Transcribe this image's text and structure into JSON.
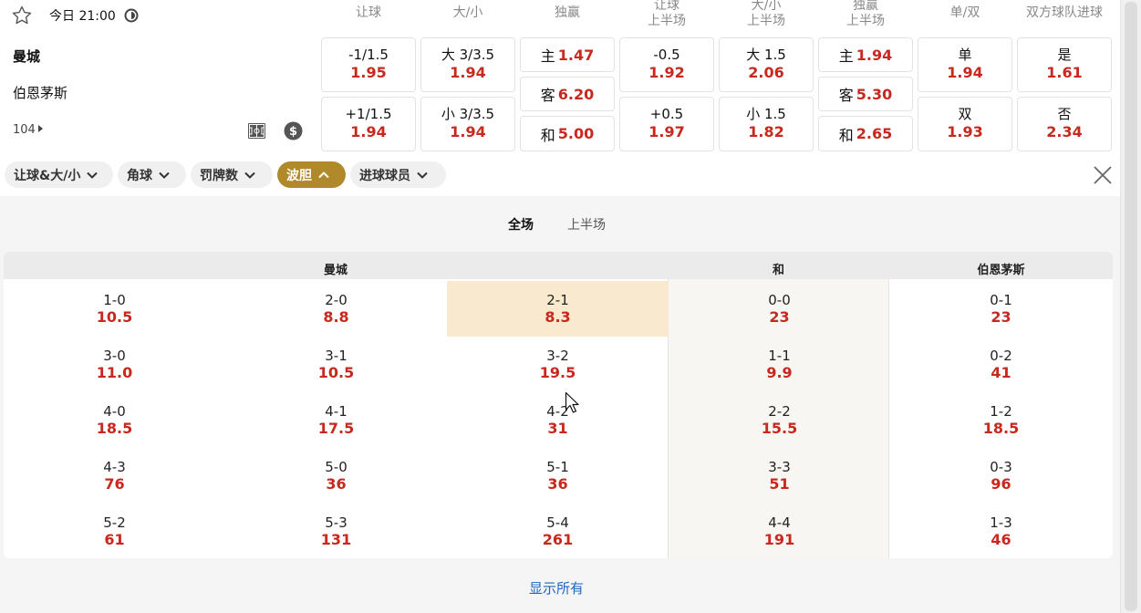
{
  "match": {
    "time": "今日 21:00",
    "home": "曼城",
    "away": "伯恩茅斯",
    "more_markets": "104"
  },
  "columns": [
    {
      "l1": "让球",
      "l2": ""
    },
    {
      "l1": "大/小",
      "l2": ""
    },
    {
      "l1": "独赢",
      "l2": ""
    },
    {
      "l1": "让球",
      "l2": "上半场"
    },
    {
      "l1": "大/小",
      "l2": "上半场"
    },
    {
      "l1": "独赢",
      "l2": "上半场"
    },
    {
      "l1": "单/双",
      "l2": ""
    },
    {
      "l1": "双方球队进球",
      "l2": ""
    }
  ],
  "odds": {
    "handicap": [
      {
        "label": "-1/1.5",
        "value": "1.95"
      },
      {
        "label": "+1/1.5",
        "value": "1.94"
      }
    ],
    "over_under": [
      {
        "label": "大 3/3.5",
        "value": "1.94"
      },
      {
        "label": "小 3/3.5",
        "value": "1.94"
      }
    ],
    "win": [
      {
        "label": "主",
        "value": "1.47"
      },
      {
        "label": "客",
        "value": "6.20"
      },
      {
        "label": "和",
        "value": "5.00"
      }
    ],
    "handicap_half": [
      {
        "label": "-0.5",
        "value": "1.92"
      },
      {
        "label": "+0.5",
        "value": "1.97"
      }
    ],
    "over_under_half": [
      {
        "label": "大 1.5",
        "value": "2.06"
      },
      {
        "label": "小 1.5",
        "value": "1.82"
      }
    ],
    "win_half": [
      {
        "label": "主",
        "value": "1.94"
      },
      {
        "label": "客",
        "value": "5.30"
      },
      {
        "label": "和",
        "value": "2.65"
      }
    ],
    "odd_even": [
      {
        "label": "单",
        "value": "1.94"
      },
      {
        "label": "双",
        "value": "1.93"
      }
    ],
    "btts": [
      {
        "label": "是",
        "value": "1.61"
      },
      {
        "label": "否",
        "value": "2.34"
      }
    ]
  },
  "filters": [
    "让球&大/小",
    "角球",
    "罚牌数",
    "波胆",
    "进球球员"
  ],
  "active_filter": "波胆",
  "period_tabs": [
    "全场",
    "上半场"
  ],
  "active_period": "全场",
  "grid_headers": {
    "home": "曼城",
    "draw": "和",
    "away": "伯恩茅斯"
  },
  "scores": {
    "home_col1": [
      {
        "s": "1-0",
        "o": "10.5"
      },
      {
        "s": "3-0",
        "o": "11.0"
      },
      {
        "s": "4-0",
        "o": "18.5"
      },
      {
        "s": "4-3",
        "o": "76"
      },
      {
        "s": "5-2",
        "o": "61"
      }
    ],
    "home_col2": [
      {
        "s": "2-0",
        "o": "8.8"
      },
      {
        "s": "3-1",
        "o": "10.5"
      },
      {
        "s": "4-1",
        "o": "17.5"
      },
      {
        "s": "5-0",
        "o": "36"
      },
      {
        "s": "5-3",
        "o": "131"
      }
    ],
    "home_col3": [
      {
        "s": "2-1",
        "o": "8.3"
      },
      {
        "s": "3-2",
        "o": "19.5"
      },
      {
        "s": "4-2",
        "o": "31"
      },
      {
        "s": "5-1",
        "o": "36"
      },
      {
        "s": "5-4",
        "o": "261"
      }
    ],
    "draw": [
      {
        "s": "0-0",
        "o": "23"
      },
      {
        "s": "1-1",
        "o": "9.9"
      },
      {
        "s": "2-2",
        "o": "15.5"
      },
      {
        "s": "3-3",
        "o": "51"
      },
      {
        "s": "4-4",
        "o": "191"
      }
    ],
    "away": [
      {
        "s": "0-1",
        "o": "23"
      },
      {
        "s": "0-2",
        "o": "41"
      },
      {
        "s": "1-2",
        "o": "18.5"
      },
      {
        "s": "0-3",
        "o": "96"
      },
      {
        "s": "1-3",
        "o": "46"
      }
    ]
  },
  "highlighted_score": "2-1",
  "show_all": "显示所有",
  "icons": [
    "star-icon",
    "live-clock-icon",
    "pitch-icon",
    "cash-icon",
    "chevron-down-icon",
    "chevron-up-icon",
    "close-icon",
    "mouse-cursor-icon"
  ],
  "colors": {
    "odds": "#c8281e",
    "active_chip": "#b08a2a",
    "highlight": "#f8e9cf",
    "link": "#1a66c2"
  }
}
